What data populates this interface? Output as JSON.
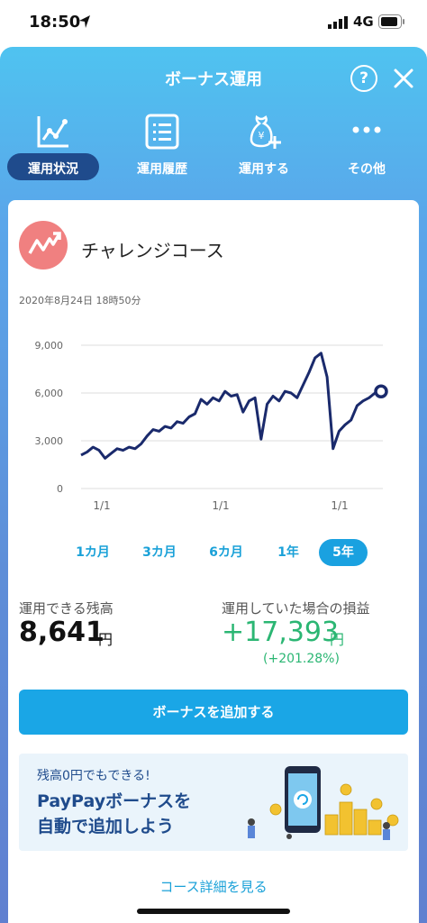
{
  "status_bar": {
    "time": "18:50",
    "network": "4G"
  },
  "header": {
    "title": "ボーナス運用",
    "help_label": "?"
  },
  "tabs": [
    {
      "label": "運用状況",
      "icon": "line-chart-icon",
      "active": true
    },
    {
      "label": "運用履歴",
      "icon": "list-icon",
      "active": false
    },
    {
      "label": "運用する",
      "icon": "yen-bag-plus-icon",
      "active": false
    },
    {
      "label": "その他",
      "icon": "more-dots-icon",
      "active": false
    }
  ],
  "course": {
    "name": "チャレンジコース",
    "timestamp": "2020年8月24日 18時50分"
  },
  "chart_data": {
    "type": "line",
    "x_tick_labels": [
      "1/1",
      "1/1",
      "1/1"
    ],
    "y_tick_labels": [
      "9,000",
      "6,000",
      "3,000",
      "0"
    ],
    "ylim": [
      0,
      9000
    ],
    "grid": true,
    "color": "#1a2a6c",
    "series": [
      {
        "x": [
          0,
          0.02,
          0.04,
          0.06,
          0.08,
          0.1,
          0.12,
          0.14,
          0.16,
          0.18,
          0.2,
          0.22,
          0.24,
          0.26,
          0.28,
          0.3,
          0.32,
          0.34,
          0.36,
          0.38,
          0.4,
          0.42,
          0.44,
          0.46,
          0.48,
          0.5,
          0.52,
          0.54,
          0.56,
          0.58,
          0.6,
          0.62,
          0.64,
          0.66,
          0.68,
          0.7,
          0.72,
          0.74,
          0.76,
          0.78,
          0.8,
          0.82,
          0.84,
          0.86,
          0.88,
          0.9,
          0.92,
          0.94,
          0.96,
          0.98,
          1.0
        ],
        "values": [
          2100,
          2300,
          2600,
          2400,
          1900,
          2200,
          2500,
          2400,
          2600,
          2500,
          2800,
          3300,
          3700,
          3600,
          3900,
          3800,
          4200,
          4100,
          4500,
          4700,
          5600,
          5300,
          5700,
          5500,
          6100,
          5800,
          5900,
          4800,
          5500,
          5700,
          3100,
          5300,
          5800,
          5500,
          6100,
          6000,
          5700,
          6500,
          7300,
          8200,
          8500,
          7000,
          2500,
          3600,
          4000,
          4300,
          5200,
          5500,
          5700,
          6000,
          6100
        ]
      }
    ]
  },
  "periods": [
    {
      "label": "1カ月",
      "active": false
    },
    {
      "label": "3カ月",
      "active": false
    },
    {
      "label": "6カ月",
      "active": false
    },
    {
      "label": "1年",
      "active": false
    },
    {
      "label": "5年",
      "active": true
    }
  ],
  "balance": {
    "label": "運用できる残高",
    "value": "8,641",
    "unit": "円"
  },
  "profit": {
    "label": "運用していた場合の損益",
    "value": "+17,393",
    "unit": "円",
    "percent": "(+201.28%)"
  },
  "add_button": {
    "label": "ボーナスを追加する"
  },
  "promo": {
    "subtitle": "残高0円でもできる!",
    "line1": "PayPayボーナスを",
    "line2": "自動で追加しよう"
  },
  "detail_link": {
    "label": "コース詳細を見る"
  }
}
